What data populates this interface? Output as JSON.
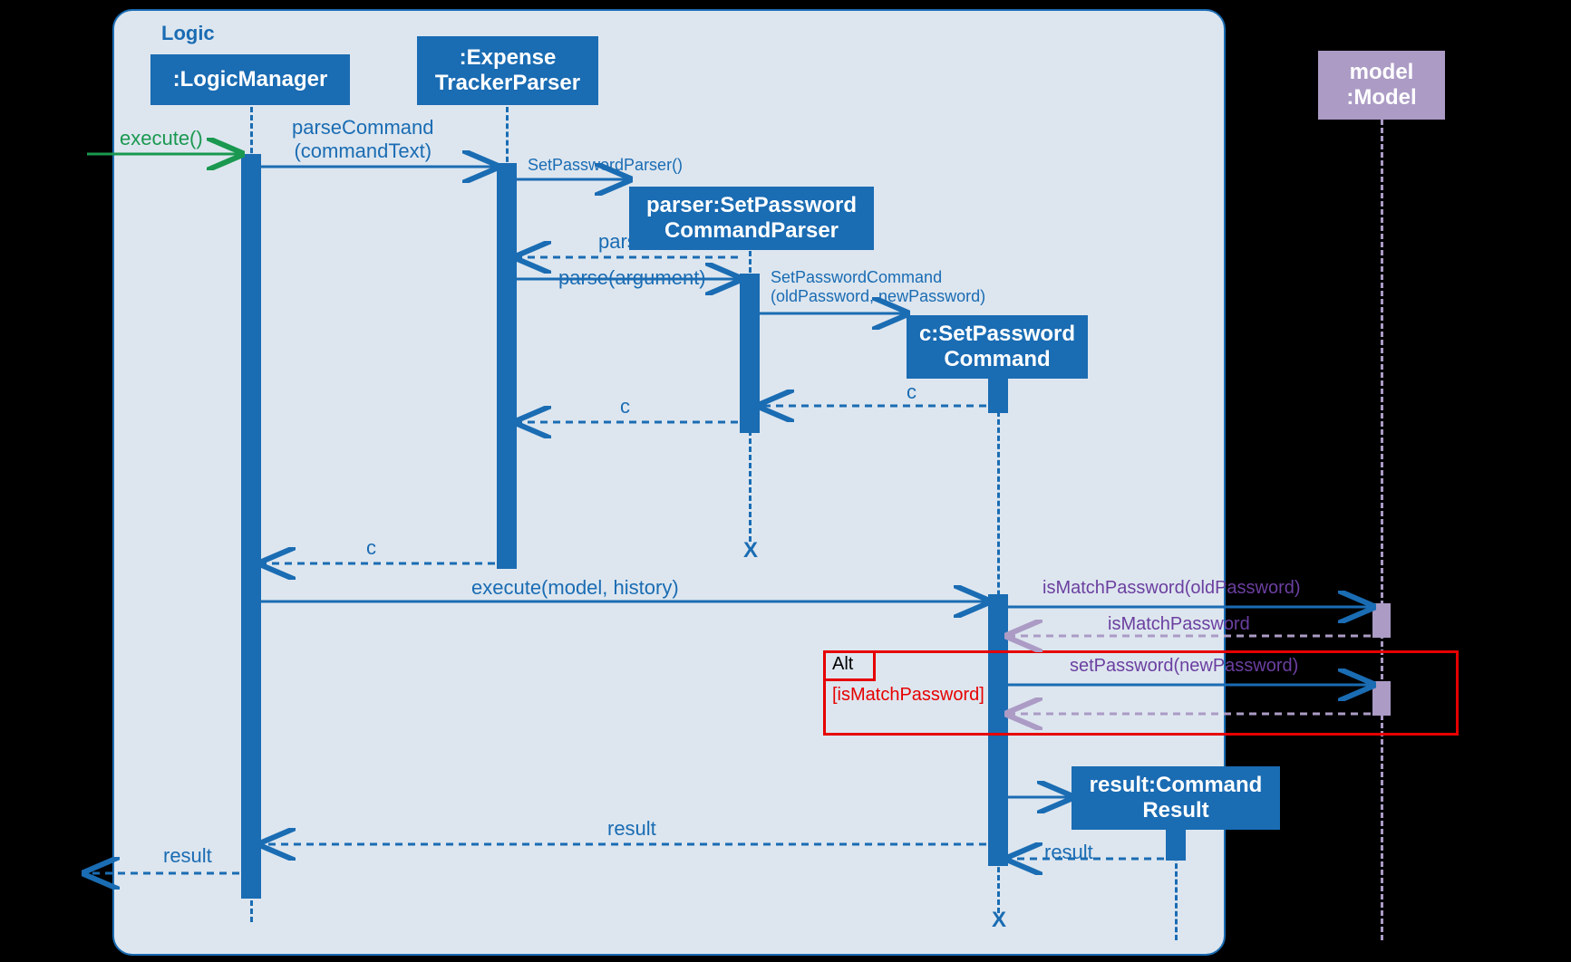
{
  "frame": {
    "label": "Logic"
  },
  "boxes": {
    "logicManager": ":LogicManager",
    "expenseTrackerParser": ":Expense\nTrackerParser",
    "setPasswordCommandParser": "parser:SetPassword\nCommandParser",
    "setPasswordCommand": "c:SetPassword\nCommand",
    "commandResult": "result:Command\nResult",
    "model": "model\n:Model"
  },
  "messages": {
    "execute": "execute()",
    "parseCommand": "parseCommand\n(commandText)",
    "setPasswordParser": "SetPasswordParser()",
    "parserReturn": "parser",
    "parseArgument": "parse(argument)",
    "setPasswordCommandCtor": "SetPasswordCommand\n(oldPassword, newPassword)",
    "cReturn1": "c",
    "cReturn2": "c",
    "cReturn3": "c",
    "executeModel": "execute(model, history)",
    "isMatchPassword": "isMatchPassword(oldPassword)",
    "isMatchPasswordReturn": "isMatchPassword",
    "setPassword": "setPassword(newPassword)",
    "resultReturn1": "result",
    "resultReturn2": "result",
    "resultReturn3": "result"
  },
  "alt": {
    "label": "Alt",
    "guard": "[isMatchPassword]"
  },
  "destroy": {
    "x1": "X",
    "x2": "X"
  }
}
